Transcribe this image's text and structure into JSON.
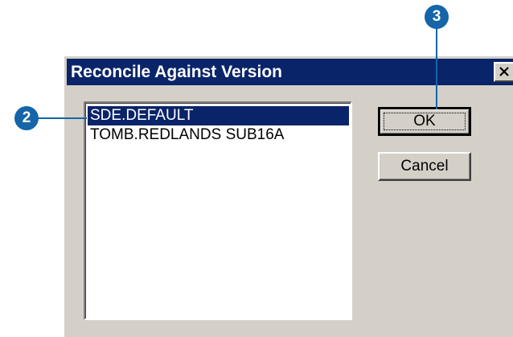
{
  "dialog": {
    "title": "Reconcile Against Version",
    "close_icon": "close-icon",
    "versions": [
      {
        "label": "SDE.DEFAULT",
        "selected": true
      },
      {
        "label": "TOMB.REDLANDS SUB16A",
        "selected": false
      }
    ],
    "ok_label": "OK",
    "cancel_label": "Cancel"
  },
  "callouts": {
    "step_2": "2",
    "step_3": "3"
  },
  "colors": {
    "titlebar": "#0a246a",
    "selection": "#0a246a",
    "dialog_face": "#d4d0c8",
    "callout": "#1565a8"
  }
}
